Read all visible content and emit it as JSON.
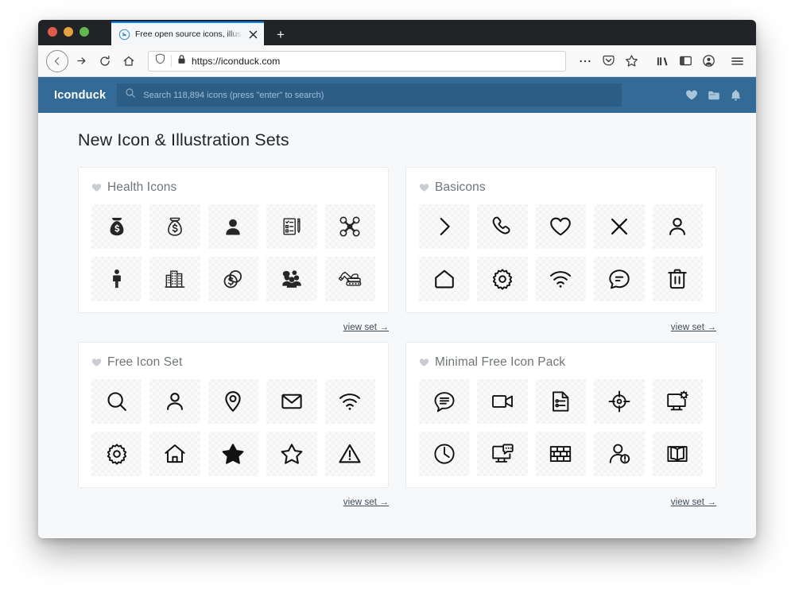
{
  "browser": {
    "tab": {
      "title": "Free open source icons, illustra",
      "favicon_name": "iconduck-duck-favicon",
      "close_label": "✕"
    },
    "new_tab_label": "+",
    "toolbar": {
      "back_label": "←",
      "forward_label": "→",
      "reload_label": "↻",
      "home_label": "home-icon",
      "url": "https://iconduck.com",
      "shield_name": "tracking-protection-shield",
      "lock_name": "padlock-icon",
      "page_actions_label": "•••",
      "pocket_name": "pocket-icon",
      "bookmark_name": "star-icon",
      "library_name": "library-icon",
      "sidebar_name": "sidebar-icon",
      "account_name": "account-icon",
      "menu_name": "hamburger-menu-icon"
    }
  },
  "site": {
    "brand": "Iconduck",
    "search": {
      "placeholder": "Search 118,894 icons (press \"enter\" to search)",
      "value": ""
    },
    "header_icons": [
      {
        "name": "heart-icon"
      },
      {
        "name": "folder-icon"
      },
      {
        "name": "bell-icon"
      }
    ]
  },
  "page": {
    "title": "New Icon & Illustration Sets",
    "view_set_label": "view set →",
    "cards": [
      {
        "title": "Health Icons",
        "icons": [
          "money-bag-filled-icon",
          "money-bag-outline-icon",
          "person-filled-icon",
          "checklist-pen-icon",
          "drone-icon",
          "standing-person-icon",
          "office-buildings-icon",
          "dollar-coins-icon",
          "group-people-icon",
          "excavator-icon"
        ]
      },
      {
        "title": "Basicons",
        "icons": [
          "chevron-right-icon",
          "phone-icon",
          "heart-outline-icon",
          "close-x-icon",
          "person-outline-icon",
          "home-outline-icon",
          "gear-icon",
          "wifi-icon",
          "chat-bubble-icon",
          "trash-icon"
        ]
      },
      {
        "title": "Free Icon Set",
        "icons": [
          "search-icon",
          "person-outline-icon",
          "location-pin-icon",
          "envelope-icon",
          "wifi-icon",
          "gear-icon",
          "home-outline-icon",
          "star-filled-icon",
          "star-outline-icon",
          "warning-triangle-icon"
        ]
      },
      {
        "title": "Minimal Free Icon Pack",
        "icons": [
          "chat-lines-icon",
          "video-camera-icon",
          "document-list-icon",
          "crosshair-icon",
          "monitor-settings-icon",
          "clock-icon",
          "monitor-chat-icon",
          "brick-wall-icon",
          "person-alert-icon",
          "open-book-icon"
        ]
      }
    ]
  },
  "colors": {
    "brand_blue": "#336b96",
    "search_blue": "#2c5e85",
    "page_bg": "#f7f8f9",
    "accent_tab": "#0a84ff"
  }
}
